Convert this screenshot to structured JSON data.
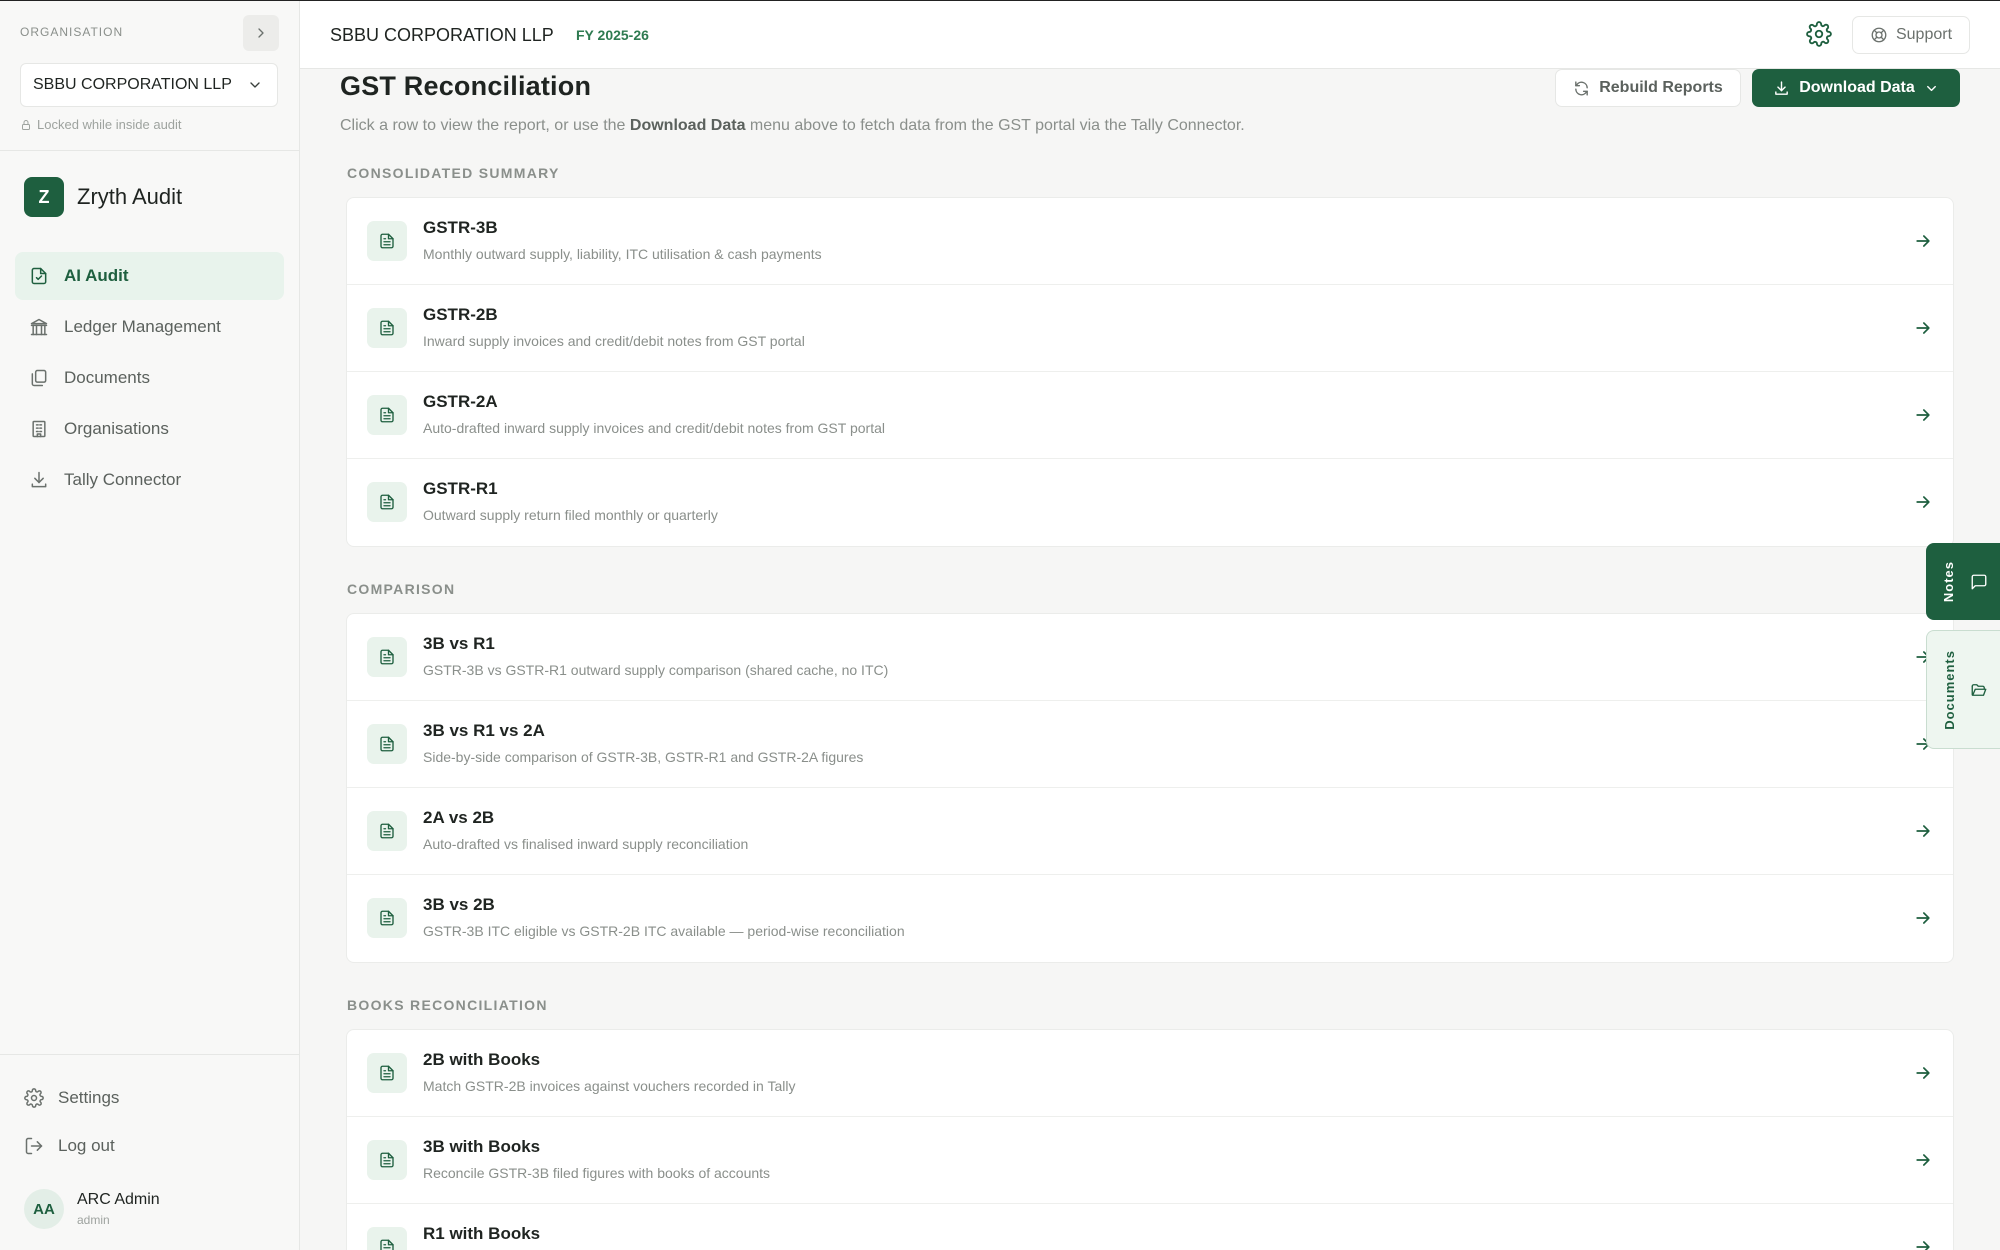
{
  "sidebar": {
    "org_label": "ORGANISATION",
    "org_selected": "SBBU CORPORATION LLP",
    "locked_text": "Locked while inside audit",
    "brand_letter": "Z",
    "brand_name": "Zryth Audit",
    "nav": [
      {
        "label": "AI Audit",
        "icon": "audit-file-icon",
        "active": true
      },
      {
        "label": "Ledger Management",
        "icon": "bank-icon",
        "active": false
      },
      {
        "label": "Documents",
        "icon": "documents-icon",
        "active": false
      },
      {
        "label": "Organisations",
        "icon": "building-icon",
        "active": false
      },
      {
        "label": "Tally Connector",
        "icon": "download-icon",
        "active": false
      }
    ],
    "settings_label": "Settings",
    "logout_label": "Log out",
    "user": {
      "initials": "AA",
      "name": "ARC Admin",
      "role": "admin"
    }
  },
  "header": {
    "org_name": "SBBU CORPORATION LLP",
    "fy": "FY 2025-26",
    "support_label": "Support"
  },
  "main": {
    "title": "GST Reconciliation",
    "subtitle_pre": "Click a row to view the report, or use the ",
    "subtitle_bold": "Download Data",
    "subtitle_post": " menu above to fetch data from the GST portal via the Tally Connector.",
    "rebuild_label": "Rebuild Reports",
    "download_label": "Download Data",
    "sections": [
      {
        "label": "CONSOLIDATED SUMMARY",
        "rows": [
          {
            "title": "GSTR-3B",
            "desc": "Monthly outward supply, liability, ITC utilisation & cash payments"
          },
          {
            "title": "GSTR-2B",
            "desc": "Inward supply invoices and credit/debit notes from GST portal"
          },
          {
            "title": "GSTR-2A",
            "desc": "Auto-drafted inward supply invoices and credit/debit notes from GST portal"
          },
          {
            "title": "GSTR-R1",
            "desc": "Outward supply return filed monthly or quarterly"
          }
        ]
      },
      {
        "label": "COMPARISON",
        "rows": [
          {
            "title": "3B vs R1",
            "desc": "GSTR-3B vs GSTR-R1 outward supply comparison (shared cache, no ITC)"
          },
          {
            "title": "3B vs R1 vs 2A",
            "desc": "Side-by-side comparison of GSTR-3B, GSTR-R1 and GSTR-2A figures"
          },
          {
            "title": "2A vs 2B",
            "desc": "Auto-drafted vs finalised inward supply reconciliation"
          },
          {
            "title": "3B vs 2B",
            "desc": "GSTR-3B ITC eligible vs GSTR-2B ITC available — period-wise reconciliation"
          }
        ]
      },
      {
        "label": "BOOKS RECONCILIATION",
        "rows": [
          {
            "title": "2B with Books",
            "desc": "Match GSTR-2B invoices against vouchers recorded in Tally"
          },
          {
            "title": "3B with Books",
            "desc": "Reconcile GSTR-3B filed figures with books of accounts"
          },
          {
            "title": "R1 with Books",
            "desc": ""
          }
        ]
      }
    ]
  },
  "side_tabs": {
    "notes_label": "Notes",
    "documents_label": "Documents"
  },
  "colors": {
    "accent": "#1e5f3f",
    "accent_light": "#e8f3ec",
    "fy_green": "#2e7a50"
  }
}
